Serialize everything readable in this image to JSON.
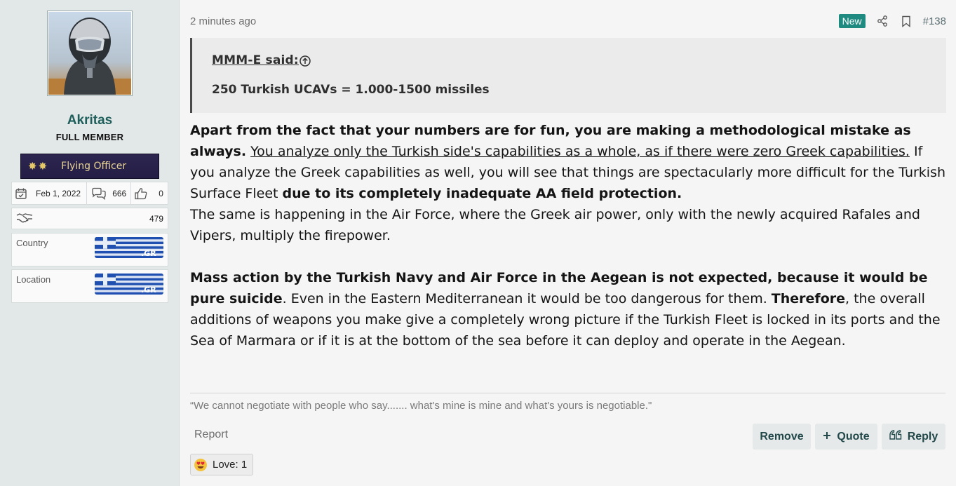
{
  "user": {
    "username": "Akritas",
    "title": "FULL MEMBER",
    "rank": "Flying Officer",
    "joined": "Feb 1, 2022",
    "messages": "666",
    "reactions": "0",
    "points": "479",
    "fields": [
      {
        "label": "Country",
        "flag_text": ".GR"
      },
      {
        "label": "Location",
        "flag_text": ".GR"
      }
    ]
  },
  "post": {
    "timestamp": "2 minutes ago",
    "badge": "New",
    "number": "#138",
    "quote": {
      "author": "MMM-E said:",
      "text": "250 Turkish UCAVs = 1.000-1500 missiles"
    },
    "body": {
      "p1_bold": "Apart from the fact that your numbers are for fun, you are making a methodological mistake as always.",
      "p1_underline": "You analyze only the Turkish side's capabilities as a whole, as if there were zero Greek capabilities.",
      "p1_text": " If you analyze the Greek capabilities as well, you will see that things are spectacularly more difficult for the Turkish Surface Fleet ",
      "p1_bold2": "due to its completely inadequate AA field protection.",
      "p2": "The same is happening in the Air Force, where the Greek air power, only with the newly acquired Rafales and Vipers, multiply the firepower.",
      "p3_bold": "Mass action by the Turkish Navy and Air Force in the Aegean is not expected, because it would be pure suicide",
      "p3_text": ". Even in the Eastern Mediterranean it would be too dangerous for them. ",
      "p3_bold2": "Therefore",
      "p3_text2": ", the overall additions of weapons you make give a completely wrong picture if the Turkish Fleet is locked in its ports and the Sea of Marmara or if it is at the bottom of the sea before it can deploy and operate in the Aegean."
    },
    "signature": "“We cannot negotiate with people who say....... what's mine is mine and what's yours is negotiable.\"",
    "actions": {
      "report": "Report",
      "remove": "Remove",
      "quote": "Quote",
      "reply": "Reply"
    },
    "reaction": {
      "label": "Love: 1",
      "emoji": "heart-eyes-emoji"
    }
  },
  "colors": {
    "accent": "#1e8a80",
    "username": "#1f5f5b",
    "sidebar_bg": "#e2e7e7",
    "button_bg": "#e6e9e9"
  }
}
